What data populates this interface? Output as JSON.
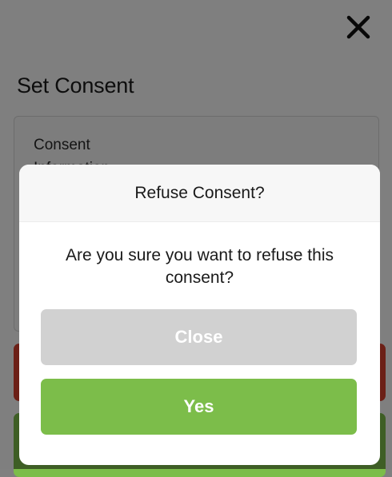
{
  "page": {
    "title": "Set Consent",
    "consent_card": {
      "label": "Consent",
      "sub_label": "Information"
    }
  },
  "dialog": {
    "title": "Refuse Consent?",
    "message": "Are you sure you want to refuse this consent?",
    "close_label": "Close",
    "yes_label": "Yes"
  },
  "icons": {
    "close": "close-icon"
  },
  "colors": {
    "accent_green": "#7cbd4a",
    "danger_red": "#d9412e",
    "disabled_gray": "#d1d1d1"
  }
}
